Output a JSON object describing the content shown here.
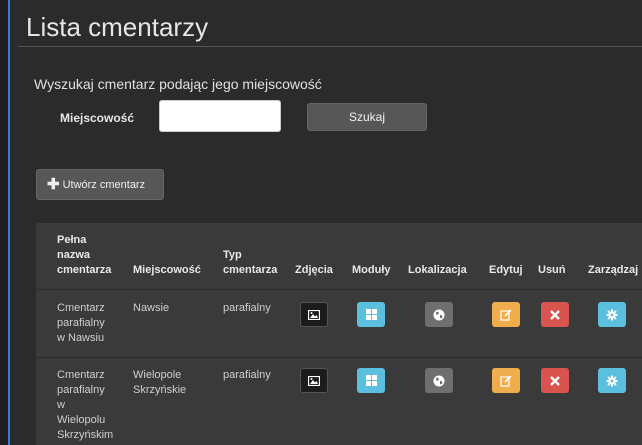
{
  "page": {
    "title": "Lista cmentarzy",
    "search_heading": "Wyszukaj cmentarz podając jego miejscowość",
    "field_label": "Miejscowość",
    "field_value": "",
    "search_button": "Szukaj",
    "create_button": "Utwórz cmentarz"
  },
  "table": {
    "headers": {
      "name": "Pełna\nnazwa\ncmentarza",
      "town": "Miejscowość",
      "type": "Typ\ncmentarza",
      "photos": "Zdjęcia",
      "modules": "Moduły",
      "location": "Lokalizacja",
      "edit": "Edytuj",
      "delete": "Usuń",
      "manage": "Zarządzaj"
    },
    "rows": [
      {
        "name": "Cmentarz\nparafialny\nw Nawsiu",
        "town": "Nawsie",
        "type": "parafialny"
      },
      {
        "name": "Cmentarz\nparafialny\nw\nWielopolu\nSkrzyńskim",
        "town": "Wielopole\nSkrzyńskie",
        "type": "parafialny"
      }
    ]
  },
  "icons": {
    "photos": "image-icon",
    "modules": "grid-icon",
    "location": "globe-icon",
    "edit": "edit-icon",
    "delete": "close-icon",
    "manage": "gear-icon",
    "create": "plus-icon"
  },
  "colors": {
    "modules": "#5bc0de",
    "location": "#6f6f6f",
    "edit": "#f0ad4e",
    "delete": "#d9534f",
    "manage": "#5bc0de"
  }
}
